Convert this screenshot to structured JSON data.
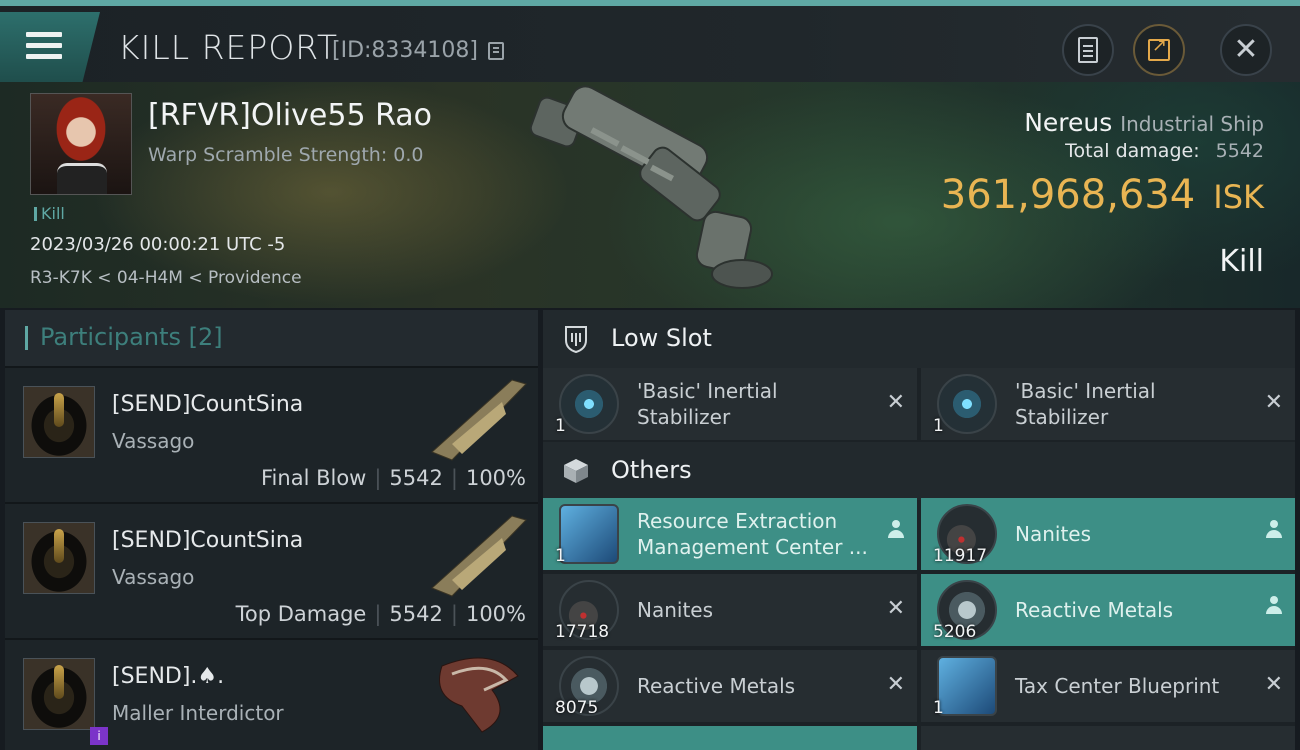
{
  "header": {
    "title": "KILL REPORT",
    "report_id": "[ID:8334108]"
  },
  "victim": {
    "name": "[RFVR]Olive55 Rao",
    "warp_scramble": "Warp Scramble Strength: 0.0",
    "tag": "Kill",
    "time": "2023/03/26 00:00:21 UTC -5",
    "location": "R3-K7K < 04-H4M < Providence",
    "ship_name": "Nereus",
    "ship_class": "Industrial Ship",
    "total_damage_label": "Total damage:",
    "total_damage": "5542",
    "isk_value": "361,968,634",
    "isk_unit": "ISK",
    "result": "Kill"
  },
  "participants": {
    "label": "Participants [2]",
    "rows": [
      {
        "name": "[SEND]CountSina",
        "ship": "Vassago",
        "role": "Final Blow",
        "damage": "5542",
        "percent": "100%"
      },
      {
        "name": "[SEND]CountSina",
        "ship": "Vassago",
        "role": "Top Damage",
        "damage": "5542",
        "percent": "100%"
      },
      {
        "name": "[SEND].♠.",
        "ship": "Maller Interdictor"
      }
    ]
  },
  "sections": {
    "low_slot": "Low Slot",
    "others": "Others"
  },
  "items": {
    "low1": {
      "name": "'Basic' Inertial Stabilizer",
      "qty": "1",
      "state": "destroyed"
    },
    "low2": {
      "name": "'Basic' Inertial Stabilizer",
      "qty": "1",
      "state": "destroyed"
    },
    "o1": {
      "name": "Resource Extraction Management Center ...",
      "qty": "1",
      "state": "dropped"
    },
    "o2": {
      "name": "Nanites",
      "qty": "11917",
      "state": "dropped"
    },
    "o3": {
      "name": "Nanites",
      "qty": "17718",
      "state": "destroyed"
    },
    "o4": {
      "name": "Reactive Metals",
      "qty": "5206",
      "state": "dropped"
    },
    "o5": {
      "name": "Reactive Metals",
      "qty": "8075",
      "state": "destroyed"
    },
    "o6": {
      "name": "Tax Center Blueprint",
      "qty": "1",
      "state": "destroyed"
    }
  },
  "glyphs": {
    "close": "✕",
    "destroyed": "✕"
  },
  "colors": {
    "accent": "#5fa8a4",
    "isk": "#e9b553",
    "dropped_bg": "#3d8f86",
    "corp_badge": "#7b34c9"
  }
}
